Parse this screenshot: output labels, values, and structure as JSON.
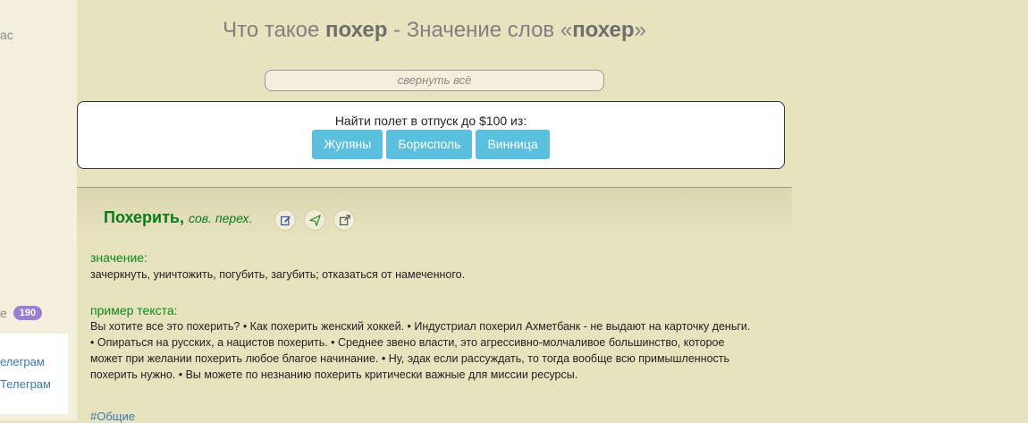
{
  "sidebar": {
    "top_text": "ас",
    "count_label": "е",
    "count": "190",
    "links": [
      "елеграм",
      "Телеграм"
    ]
  },
  "page": {
    "title_prefix": "Что такое ",
    "title_word1": "похер",
    "title_middle": " - Значение слов «",
    "title_word2": "похер",
    "title_suffix": "»",
    "collapse_label": "свернуть всё"
  },
  "flight": {
    "prompt": "Найти полет в отпуск до $100 из:",
    "buttons": [
      "Жуляны",
      "Борисполь",
      "Винница"
    ]
  },
  "entry": {
    "headword": "Похерить,",
    "grammar": "сов. перех.",
    "icons": [
      "edit-icon",
      "send-icon",
      "external-link-icon"
    ],
    "meaning_label": "значение:",
    "meaning": "зачеркнуть, уничтожить, погубить, загубить; отказаться от намеченного.",
    "example_label": "пример текста:",
    "examples": [
      "Вы хотите все это похерить? • Как похерить женский хоккей. • Индустриал похерил Ахметбанк - не выдают на карточку деньги.",
      "• Опираться на русских, а нацистов похерить. • Среднее звено власти, это агрессивно-молчаливое большинство, которое",
      "может при желании похерить любое благое начинание. • Ну, эдак если рассуждать, то тогда вообще всю примышленность",
      "похерить нужно. • Вы можете по незнанию похерить критически важные для миссии ресурсы."
    ],
    "hashtag": "#Общие"
  },
  "colors": {
    "background": "#e8e3bf",
    "accent_green": "#0a7a1a",
    "button_blue": "#5bc0de",
    "badge_purple": "#9b7fd4"
  }
}
